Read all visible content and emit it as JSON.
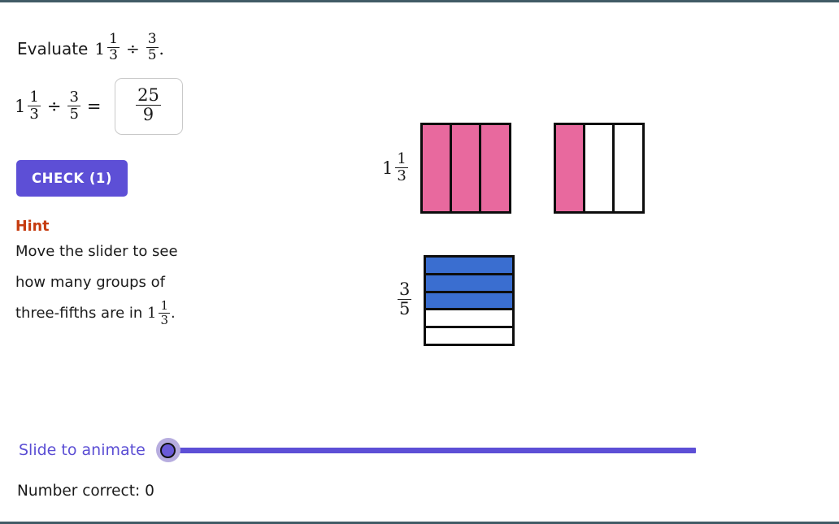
{
  "problem": {
    "stem": "Evaluate",
    "period": ".",
    "dividend": {
      "whole": "1",
      "numerator": "1",
      "denominator": "3"
    },
    "divisor": {
      "numerator": "3",
      "denominator": "5"
    },
    "divide_symbol": "÷",
    "equals_symbol": "="
  },
  "answer": {
    "numerator": "25",
    "denominator": "9"
  },
  "check": {
    "label": "CHECK (1)",
    "color": "#5d4fd6"
  },
  "hint": {
    "title": "Hint",
    "title_color": "#c63c10",
    "line1": "Move the slider to see",
    "line2": "how many groups of",
    "line3_prefix": "three-fifths are in",
    "line3_whole": "1",
    "line3_numerator": "1",
    "line3_denominator": "3",
    "line3_suffix": "."
  },
  "diagrams": {
    "dividend": {
      "label_whole": "1",
      "label_numerator": "1",
      "label_denominator": "3",
      "fill_color": "#e8699e",
      "orientation": "vertical",
      "squares": [
        {
          "parts": 3,
          "filled": 3
        },
        {
          "parts": 3,
          "filled": 1
        }
      ]
    },
    "divisor": {
      "label_numerator": "3",
      "label_denominator": "5",
      "fill_color": "#3a6ed0",
      "orientation": "horizontal",
      "squares": [
        {
          "parts": 5,
          "filled": 3
        }
      ]
    }
  },
  "slider": {
    "label": "Slide to animate",
    "label_color": "#5b4ed4",
    "value": 0,
    "min": 0,
    "max": 100
  },
  "score": {
    "text": "Number correct: 0"
  },
  "frame": {
    "border_color": "#415b66"
  }
}
